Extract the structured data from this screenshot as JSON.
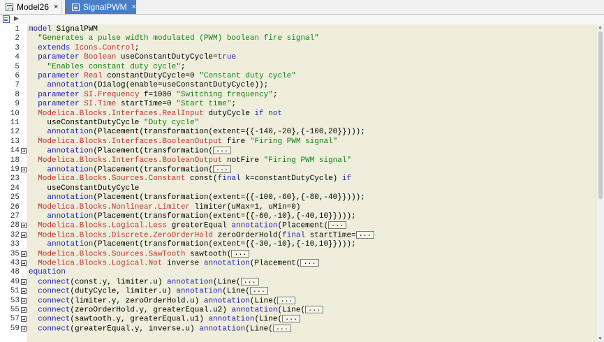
{
  "tabs": [
    {
      "label": "Model26",
      "close": "×",
      "active": false
    },
    {
      "label": "SignalPWM",
      "close": "×",
      "active": true
    }
  ],
  "lines": [
    {
      "n": "1",
      "fold": false,
      "indent": 0,
      "parts": [
        [
          "kw",
          "model"
        ],
        [
          "",
          "SignalPWM"
        ]
      ]
    },
    {
      "n": "2",
      "fold": false,
      "indent": 1,
      "parts": [
        [
          "str",
          "\"Generates a pulse width modulated (PWM) boolean fire signal\""
        ]
      ]
    },
    {
      "n": "3",
      "fold": false,
      "indent": 1,
      "parts": [
        [
          "kw",
          "extends"
        ],
        [
          "ty",
          "Icons.Control"
        ],
        [
          "",
          ";"
        ]
      ]
    },
    {
      "n": "4",
      "fold": false,
      "indent": 1,
      "parts": [
        [
          "kw",
          "parameter"
        ],
        [
          "ty",
          "Boolean"
        ],
        [
          "",
          "useConstantDutyCycle="
        ],
        [
          "kw",
          "true"
        ]
      ]
    },
    {
      "n": "5",
      "fold": false,
      "indent": 2,
      "parts": [
        [
          "str",
          "\"Enables constant duty cycle\""
        ],
        [
          "",
          ";"
        ]
      ]
    },
    {
      "n": "6",
      "fold": false,
      "indent": 1,
      "parts": [
        [
          "kw",
          "parameter"
        ],
        [
          "ty",
          "Real"
        ],
        [
          "",
          "constantDutyCycle=0"
        ],
        [
          "str",
          "\"Constant duty cycle\""
        ]
      ]
    },
    {
      "n": "7",
      "fold": false,
      "indent": 2,
      "parts": [
        [
          "kw",
          "annotation"
        ],
        [
          "",
          "(Dialog(enable=useConstantDutyCycle));"
        ]
      ]
    },
    {
      "n": "8",
      "fold": false,
      "indent": 1,
      "parts": [
        [
          "kw",
          "parameter"
        ],
        [
          "ty",
          "SI.Frequency"
        ],
        [
          "",
          "f=1000"
        ],
        [
          "str",
          "\"Switching frequency\""
        ],
        [
          "",
          ";"
        ]
      ]
    },
    {
      "n": "9",
      "fold": false,
      "indent": 1,
      "parts": [
        [
          "kw",
          "parameter"
        ],
        [
          "ty",
          "SI.Time"
        ],
        [
          "",
          "startTime=0"
        ],
        [
          "str",
          "\"Start time\""
        ],
        [
          "",
          ";"
        ]
      ]
    },
    {
      "n": "10",
      "fold": false,
      "indent": 1,
      "parts": [
        [
          "ty",
          "Modelica.Blocks.Interfaces.RealInput"
        ],
        [
          "",
          "dutyCycle"
        ],
        [
          "kw",
          "if not"
        ]
      ]
    },
    {
      "n": "11",
      "fold": false,
      "indent": 2,
      "parts": [
        [
          "",
          "useConstantDutyCycle"
        ],
        [
          "str",
          "\"Duty cycle\""
        ]
      ]
    },
    {
      "n": "12",
      "fold": false,
      "indent": 2,
      "parts": [
        [
          "kw",
          "annotation"
        ],
        [
          "",
          "(Placement(transformation(extent={{-140,-20},{-100,20}})));"
        ]
      ]
    },
    {
      "n": "13",
      "fold": false,
      "indent": 1,
      "parts": [
        [
          "ty",
          "Modelica.Blocks.Interfaces.BooleanOutput"
        ],
        [
          "",
          "fire"
        ],
        [
          "str",
          "\"Firing PWM signal\""
        ]
      ]
    },
    {
      "n": "14",
      "fold": true,
      "indent": 2,
      "parts": [
        [
          "kw",
          "annotation"
        ],
        [
          "",
          "(Placement(transformation("
        ]
      ],
      "ellipsis": "..."
    },
    {
      "n": "18",
      "fold": false,
      "indent": 1,
      "parts": [
        [
          "ty",
          "Modelica.Blocks.Interfaces.BooleanOutput"
        ],
        [
          "",
          "notFire"
        ],
        [
          "str",
          "\"Firing PWM signal\""
        ]
      ]
    },
    {
      "n": "19",
      "fold": true,
      "indent": 2,
      "parts": [
        [
          "kw",
          "annotation"
        ],
        [
          "",
          "(Placement(transformation("
        ]
      ],
      "ellipsis": "..."
    },
    {
      "n": "23",
      "fold": false,
      "indent": 1,
      "parts": [
        [
          "ty",
          "Modelica.Blocks.Sources.Constant"
        ],
        [
          "",
          "const("
        ],
        [
          "kw",
          "final"
        ],
        [
          "",
          "k=constantDutyCycle)"
        ],
        [
          "kw",
          "if"
        ]
      ]
    },
    {
      "n": "24",
      "fold": false,
      "indent": 2,
      "parts": [
        [
          "",
          "useConstantDutyCycle"
        ]
      ]
    },
    {
      "n": "25",
      "fold": false,
      "indent": 2,
      "parts": [
        [
          "kw",
          "annotation"
        ],
        [
          "",
          "(Placement(transformation(extent={{-100,-60},{-80,-40}})));"
        ]
      ]
    },
    {
      "n": "26",
      "fold": false,
      "indent": 1,
      "parts": [
        [
          "ty",
          "Modelica.Blocks.Nonlinear.Limiter"
        ],
        [
          "",
          "limiter(uMax=1, uMin=0)"
        ]
      ]
    },
    {
      "n": "27",
      "fold": false,
      "indent": 2,
      "parts": [
        [
          "kw",
          "annotation"
        ],
        [
          "",
          "(Placement(transformation(extent={{-60,-10},{-40,10}})));"
        ]
      ]
    },
    {
      "n": "28",
      "fold": true,
      "indent": 1,
      "parts": [
        [
          "ty",
          "Modelica.Blocks.Logical.Less"
        ],
        [
          "",
          "greaterEqual"
        ],
        [
          "kw",
          "annotation"
        ],
        [
          "",
          "(Placement("
        ]
      ],
      "ellipsis": "..."
    },
    {
      "n": "32",
      "fold": true,
      "indent": 1,
      "parts": [
        [
          "ty",
          "Modelica.Blocks.Discrete.ZeroOrderHold"
        ],
        [
          "",
          "zeroOrderHold("
        ],
        [
          "kw",
          "final"
        ],
        [
          "",
          "startTime="
        ]
      ],
      "ellipsis": "..."
    },
    {
      "n": "33",
      "fold": false,
      "indent": 2,
      "parts": [
        [
          "kw",
          "annotation"
        ],
        [
          "",
          "(Placement(transformation(extent={{-30,-10},{-10,10}})));"
        ]
      ]
    },
    {
      "n": "35",
      "fold": true,
      "indent": 1,
      "parts": [
        [
          "ty",
          "Modelica.Blocks.Sources.SawTooth"
        ],
        [
          "",
          "sawtooth("
        ]
      ],
      "ellipsis": "..."
    },
    {
      "n": "43",
      "fold": true,
      "indent": 1,
      "parts": [
        [
          "ty",
          "Modelica.Blocks.Logical.Not"
        ],
        [
          "",
          "inverse"
        ],
        [
          "kw",
          "annotation"
        ],
        [
          "",
          "(Placement("
        ]
      ],
      "ellipsis": "..."
    },
    {
      "n": "48",
      "fold": false,
      "indent": 0,
      "parts": [
        [
          "kw",
          "equation"
        ]
      ]
    },
    {
      "n": "49",
      "fold": true,
      "indent": 1,
      "parts": [
        [
          "kw",
          "connect"
        ],
        [
          "",
          "(const.y, limiter.u)"
        ],
        [
          "kw",
          "annotation"
        ],
        [
          "",
          "(Line("
        ]
      ],
      "ellipsis": "..."
    },
    {
      "n": "51",
      "fold": true,
      "indent": 1,
      "parts": [
        [
          "kw",
          "connect"
        ],
        [
          "",
          "(dutyCycle, limiter.u)"
        ],
        [
          "kw",
          "annotation"
        ],
        [
          "",
          "(Line("
        ]
      ],
      "ellipsis": "..."
    },
    {
      "n": "53",
      "fold": true,
      "indent": 1,
      "parts": [
        [
          "kw",
          "connect"
        ],
        [
          "",
          "(limiter.y, zeroOrderHold.u)"
        ],
        [
          "kw",
          "annotation"
        ],
        [
          "",
          "(Line("
        ]
      ],
      "ellipsis": "..."
    },
    {
      "n": "55",
      "fold": true,
      "indent": 1,
      "parts": [
        [
          "kw",
          "connect"
        ],
        [
          "",
          "(zeroOrderHold.y, greaterEqual.u2)"
        ],
        [
          "kw",
          "annotation"
        ],
        [
          "",
          "(Line("
        ]
      ],
      "ellipsis": "..."
    },
    {
      "n": "57",
      "fold": true,
      "indent": 1,
      "parts": [
        [
          "kw",
          "connect"
        ],
        [
          "",
          "(sawtooth.y, greaterEqual.u1)"
        ],
        [
          "kw",
          "annotation"
        ],
        [
          "",
          "(Line("
        ]
      ],
      "ellipsis": "..."
    },
    {
      "n": "59",
      "fold": true,
      "indent": 1,
      "parts": [
        [
          "kw",
          "connect"
        ],
        [
          "",
          "(greaterEqual.y, inverse.u)"
        ],
        [
          "kw",
          "annotation"
        ],
        [
          "",
          "(Line("
        ]
      ],
      "ellipsis": "..."
    }
  ]
}
